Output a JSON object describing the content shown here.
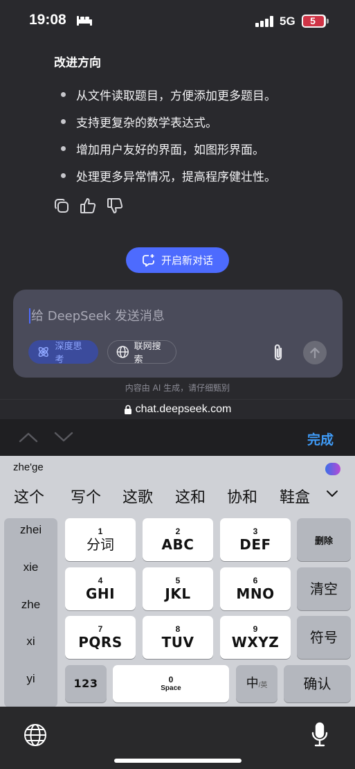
{
  "status_bar": {
    "time": "19:08",
    "network": "5G",
    "battery": "5"
  },
  "message": {
    "heading": "改进方向",
    "bullets": [
      "从文件读取题目，方便添加更多题目。",
      "支持更复杂的数学表达式。",
      "增加用户友好的界面，如图形界面。",
      "处理更多异常情况，提高程序健壮性。"
    ],
    "actions": {
      "copy_icon": "copy-icon",
      "like_icon": "thumbs-up-icon",
      "dislike_icon": "thumbs-down-icon"
    }
  },
  "new_chat_label": "开启新对话",
  "composer": {
    "placeholder": "给 DeepSeek 发送消息",
    "deep_think_label": "深度思考",
    "web_search_label": "联网搜索"
  },
  "disclaimer": "内容由 AI 生成，请仔细甄别",
  "url": "chat.deepseek.com",
  "keyboard_toolbar": {
    "done_label": "完成"
  },
  "keyboard": {
    "pinyin": "zhe'ge",
    "candidates": [
      "这个",
      "写个",
      "这歌",
      "这和",
      "协和",
      "鞋盒"
    ],
    "pinyin_options": [
      "zhei",
      "xie",
      "zhe",
      "xi",
      "yi"
    ],
    "keys": {
      "k1": {
        "num": "1",
        "label": "分词"
      },
      "k2": {
        "num": "2",
        "label": "ABC"
      },
      "k3": {
        "num": "3",
        "label": "DEF"
      },
      "k4": {
        "num": "4",
        "label": "GHI"
      },
      "k5": {
        "num": "5",
        "label": "JKL"
      },
      "k6": {
        "num": "6",
        "label": "MNO"
      },
      "k7": {
        "num": "7",
        "label": "PQRS"
      },
      "k8": {
        "num": "8",
        "label": "TUV"
      },
      "k9": {
        "num": "9",
        "label": "WXYZ"
      },
      "k0": {
        "num": "0",
        "label": "Space"
      }
    },
    "delete_label": "删除",
    "clear_label": "清空",
    "symbols_label": "符号",
    "num123_label": "123",
    "lang_label": "中",
    "lang_alt": "/英",
    "confirm_label": "确认"
  },
  "colors": {
    "accent": "#4d6bfe",
    "done": "#3f9bf7",
    "battery_low": "#cf3446"
  }
}
